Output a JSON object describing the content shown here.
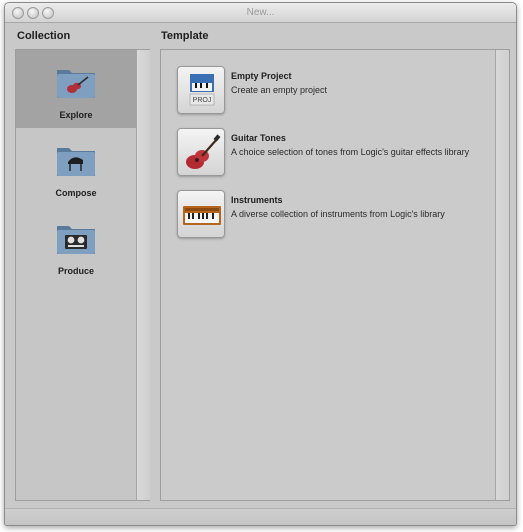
{
  "window": {
    "title": "New..."
  },
  "headers": {
    "collection": "Collection",
    "template": "Template"
  },
  "collection": {
    "items": [
      {
        "label": "Explore",
        "icon": "guitar-folder-icon",
        "selected": true
      },
      {
        "label": "Compose",
        "icon": "piano-folder-icon",
        "selected": false
      },
      {
        "label": "Produce",
        "icon": "tape-deck-folder-icon",
        "selected": false
      }
    ]
  },
  "templates": {
    "items": [
      {
        "title": "Empty Project",
        "description": "Create an empty project",
        "icon": "empty-project-icon",
        "badge": "PROJ"
      },
      {
        "title": "Guitar Tones",
        "description": "A choice selection of tones from Logic's guitar effects library",
        "icon": "guitar-icon"
      },
      {
        "title": "Instruments",
        "description": "A diverse collection of instruments from Logic's library",
        "icon": "keyboard-icon"
      }
    ]
  },
  "colors": {
    "window_bg": "#c9c9c9",
    "selected_bg": "#a3a3a3",
    "folder_blue": "#6f8fb0"
  }
}
